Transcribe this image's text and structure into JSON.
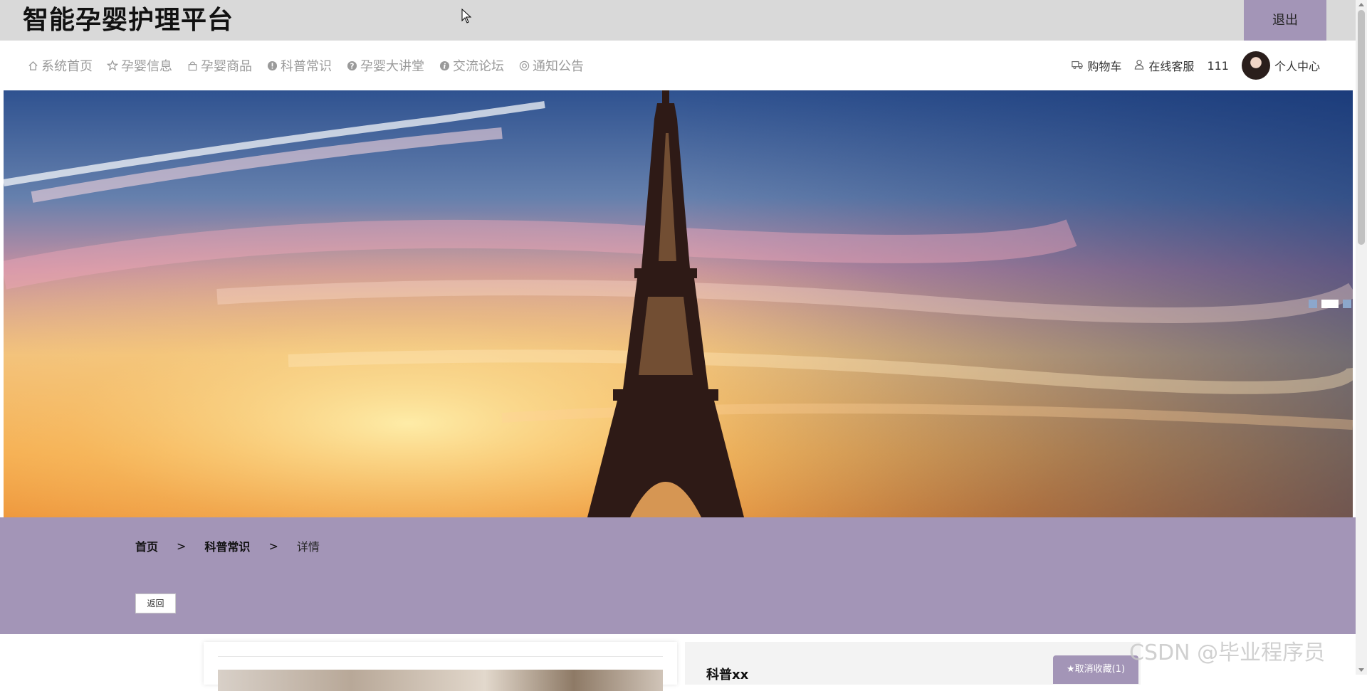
{
  "site": {
    "title": "智能孕婴护理平台",
    "logout_label": "退出"
  },
  "nav": {
    "items": [
      {
        "label": "系统首页",
        "icon": "home-icon"
      },
      {
        "label": "孕婴信息",
        "icon": "star-icon"
      },
      {
        "label": "孕婴商品",
        "icon": "bag-icon"
      },
      {
        "label": "科普常识",
        "icon": "info-circle-icon"
      },
      {
        "label": "孕婴大讲堂",
        "icon": "question-circle-icon"
      },
      {
        "label": "交流论坛",
        "icon": "info-italic-icon"
      },
      {
        "label": "通知公告",
        "icon": "circle-icon"
      }
    ],
    "cart_label": "购物车",
    "service_label": "在线客服",
    "user_count": "111",
    "profile_label": "个人中心"
  },
  "banner": {
    "slide_count": 3,
    "active_slide": 2
  },
  "breadcrumb": {
    "home": "首页",
    "sep1": ">",
    "category": "科普常识",
    "sep2": ">",
    "current": "详情"
  },
  "back_label": "返回",
  "detail": {
    "title": "科普xx",
    "favorite_label": "★取消收藏(1)"
  },
  "watermark": "CSDN @毕业程序员",
  "colors": {
    "accent": "#a395b7",
    "topbar": "#d9d9d9",
    "nav_text": "#9a9a9a"
  }
}
